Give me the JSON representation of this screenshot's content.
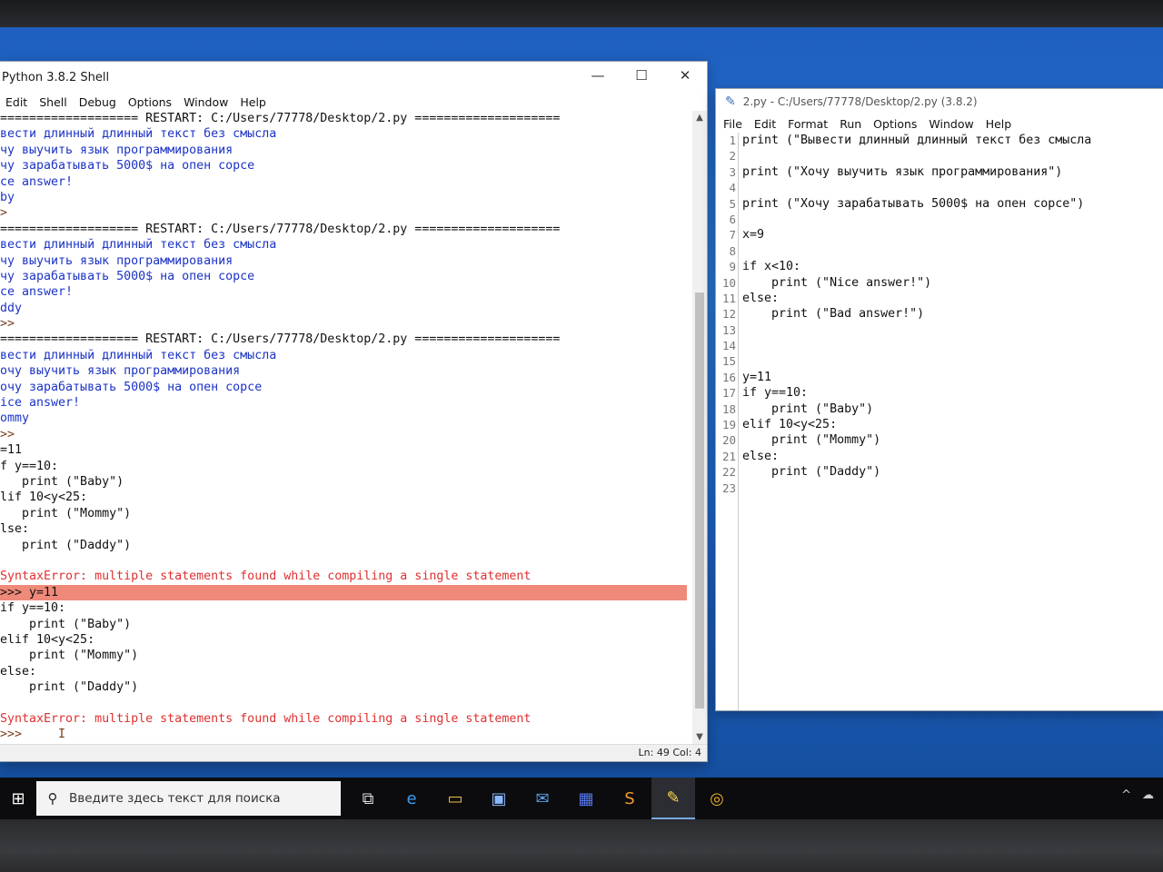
{
  "shell": {
    "title": "Python 3.8.2 Shell",
    "menu": [
      "Edit",
      "Shell",
      "Debug",
      "Options",
      "Window",
      "Help"
    ],
    "controls": {
      "minimize": "—",
      "maximize": "☐",
      "close": "✕"
    },
    "lines": [
      {
        "text": "=================== RESTART: C:/Users/77778/Desktop/2.py ====================",
        "cls": "txt"
      },
      {
        "text": "вести длинный длинный текст без смысла",
        "cls": "out"
      },
      {
        "text": "чу выучить язык программирования",
        "cls": "out"
      },
      {
        "text": "чу зарабатывать 5000$ на опен сорсе",
        "cls": "out"
      },
      {
        "text": "ce answer!",
        "cls": "out"
      },
      {
        "text": "by",
        "cls": "out"
      },
      {
        "text": ">",
        "cls": "prm"
      },
      {
        "text": "=================== RESTART: C:/Users/77778/Desktop/2.py ====================",
        "cls": "txt"
      },
      {
        "text": "вести длинный длинный текст без смысла",
        "cls": "out"
      },
      {
        "text": "чу выучить язык программирования",
        "cls": "out"
      },
      {
        "text": "чу зарабатывать 5000$ на опен сорсе",
        "cls": "out"
      },
      {
        "text": "ce answer!",
        "cls": "out"
      },
      {
        "text": "ddy",
        "cls": "out"
      },
      {
        "text": ">>",
        "cls": "prm"
      },
      {
        "text": "=================== RESTART: C:/Users/77778/Desktop/2.py ====================",
        "cls": "txt"
      },
      {
        "text": "вести длинный длинный текст без смысла",
        "cls": "out"
      },
      {
        "text": "очу выучить язык программирования",
        "cls": "out"
      },
      {
        "text": "очу зарабатывать 5000$ на опен сорсе",
        "cls": "out"
      },
      {
        "text": "ice answer!",
        "cls": "out"
      },
      {
        "text": "ommy",
        "cls": "out"
      },
      {
        "text": ">>",
        "cls": "prm"
      },
      {
        "text": "=11",
        "cls": "txt"
      },
      {
        "text": "f y==10:",
        "cls": "txt"
      },
      {
        "text": "   print (\"Baby\")",
        "cls": "txt"
      },
      {
        "text": "lif 10<y<25:",
        "cls": "txt"
      },
      {
        "text": "   print (\"Mommy\")",
        "cls": "txt"
      },
      {
        "text": "lse:",
        "cls": "txt"
      },
      {
        "text": "   print (\"Daddy\")",
        "cls": "txt"
      },
      {
        "text": "",
        "cls": "txt"
      },
      {
        "text": "SyntaxError: multiple statements found while compiling a single statement",
        "cls": "err"
      },
      {
        "text": ">>> y=11",
        "cls": "txt hl"
      },
      {
        "text": "if y==10:",
        "cls": "txt"
      },
      {
        "text": "    print (\"Baby\")",
        "cls": "txt"
      },
      {
        "text": "elif 10<y<25:",
        "cls": "txt"
      },
      {
        "text": "    print (\"Mommy\")",
        "cls": "txt"
      },
      {
        "text": "else:",
        "cls": "txt"
      },
      {
        "text": "    print (\"Daddy\")",
        "cls": "txt"
      },
      {
        "text": "",
        "cls": "txt"
      },
      {
        "text": "SyntaxError: multiple statements found while compiling a single statement",
        "cls": "err"
      },
      {
        "text": ">>>     I",
        "cls": "prm"
      }
    ],
    "status": "Ln: 49  Col: 4"
  },
  "editor": {
    "title": "2.py - C:/Users/77778/Desktop/2.py (3.8.2)",
    "menu": [
      "File",
      "Edit",
      "Format",
      "Run",
      "Options",
      "Window",
      "Help"
    ],
    "lines": [
      {
        "n": "1",
        "text": "print (\"Вывести длинный длинный текст без смысла"
      },
      {
        "n": "2",
        "text": ""
      },
      {
        "n": "3",
        "text": "print (\"Хочу выучить язык программирования\")"
      },
      {
        "n": "4",
        "text": ""
      },
      {
        "n": "5",
        "text": "print (\"Хочу зарабатывать 5000$ на опен сорсе\")"
      },
      {
        "n": "6",
        "text": ""
      },
      {
        "n": "7",
        "text": "x=9"
      },
      {
        "n": "8",
        "text": ""
      },
      {
        "n": "9",
        "text": "if x<10:"
      },
      {
        "n": "10",
        "text": "    print (\"Nice answer!\")"
      },
      {
        "n": "11",
        "text": "else:"
      },
      {
        "n": "12",
        "text": "    print (\"Bad answer!\")"
      },
      {
        "n": "13",
        "text": ""
      },
      {
        "n": "14",
        "text": ""
      },
      {
        "n": "15",
        "text": ""
      },
      {
        "n": "16",
        "text": "y=11"
      },
      {
        "n": "17",
        "text": "if y==10:"
      },
      {
        "n": "18",
        "text": "    print (\"Baby\")"
      },
      {
        "n": "19",
        "text": "elif 10<y<25:"
      },
      {
        "n": "20",
        "text": "    print (\"Mommy\")"
      },
      {
        "n": "21",
        "text": "else:"
      },
      {
        "n": "22",
        "text": "    print (\"Daddy\")"
      },
      {
        "n": "23",
        "text": ""
      }
    ]
  },
  "taskbar": {
    "search_placeholder": "Введите здесь текст для поиска",
    "icons": [
      "task-view-icon",
      "edge-icon",
      "file-explorer-icon",
      "store-icon",
      "mail-icon",
      "app-icon",
      "sublime-icon",
      "idle-icon",
      "chrome-icon"
    ]
  }
}
